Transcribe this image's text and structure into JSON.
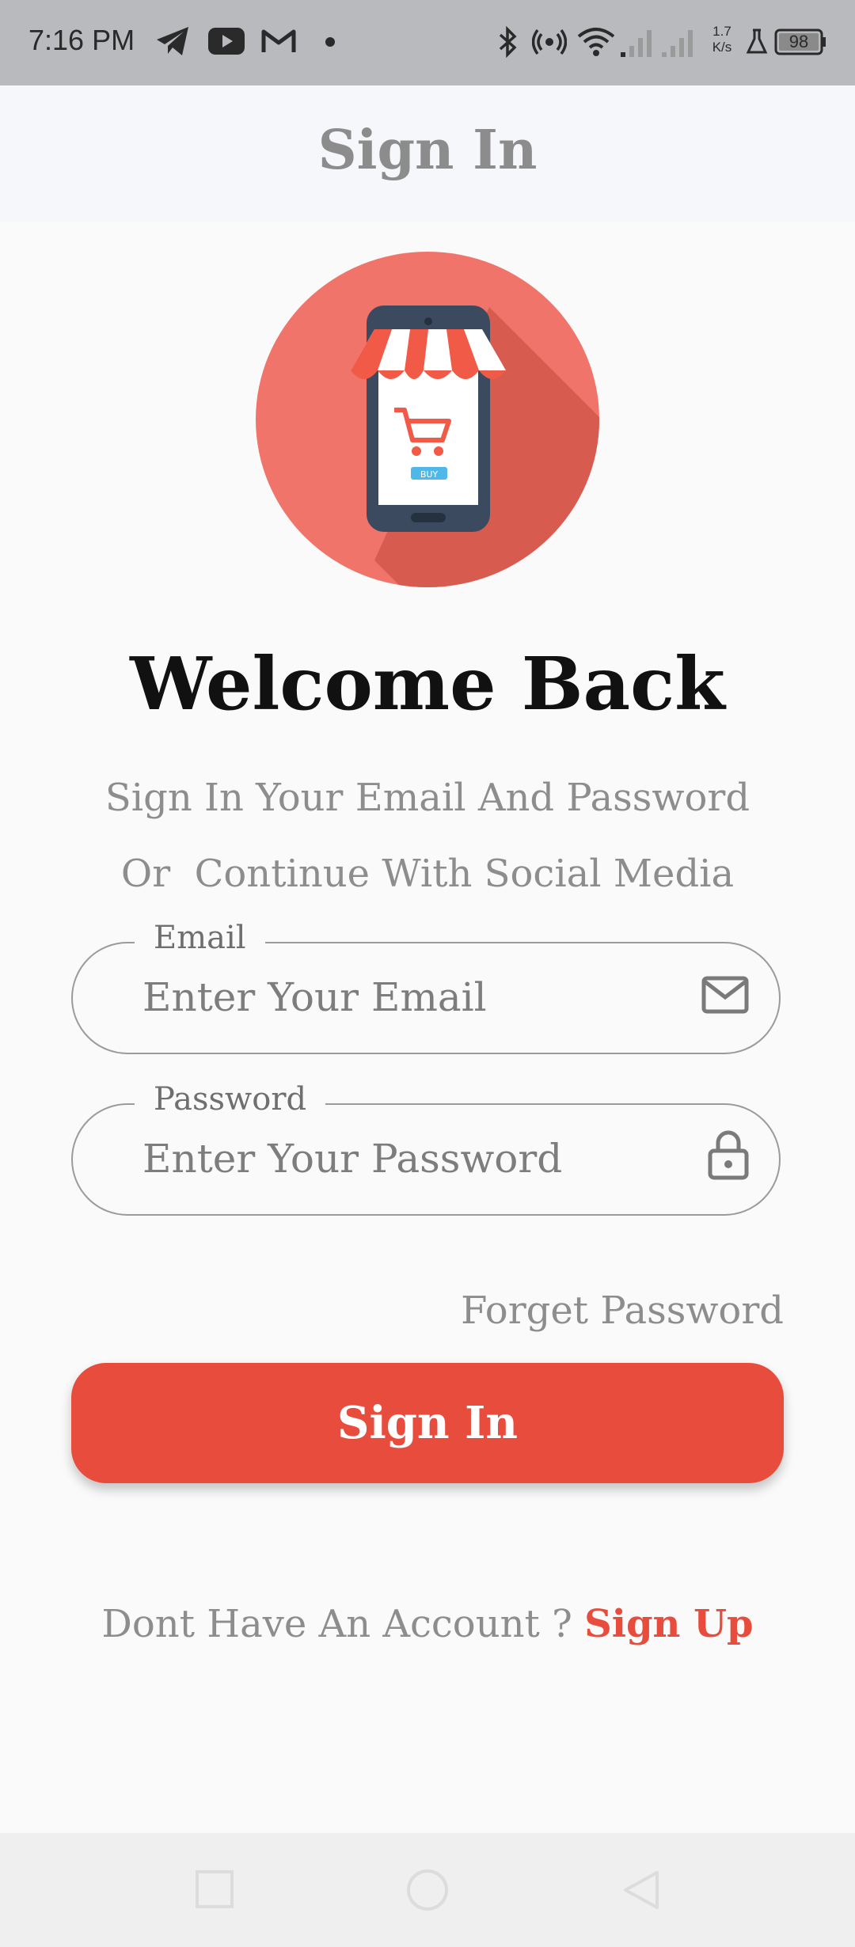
{
  "status_bar": {
    "time": "7:16 PM",
    "net_speed_top": "1.7",
    "net_speed_bottom": "K/s",
    "battery": "98",
    "icons": [
      "telegram-icon",
      "youtube-icon",
      "gmail-icon",
      "dot-icon",
      "bluetooth-icon",
      "hotspot-icon",
      "wifi-icon",
      "signal-icon",
      "signal-icon-2",
      "flask-icon",
      "battery-icon"
    ]
  },
  "app_bar": {
    "title": "Sign In"
  },
  "logo": {
    "icon": "shop-phone-cart-icon",
    "badge": "BUY",
    "accent": "#f07469"
  },
  "welcome": {
    "title": "Welcome Back",
    "line1": "Sign In Your Email And Password",
    "line2": "Or  Continue With Social Media"
  },
  "email": {
    "label": "Email",
    "placeholder": "Enter Your Email",
    "icon": "mail-icon"
  },
  "password": {
    "label": "Password",
    "placeholder": "Enter Your Password",
    "icon": "lock-icon"
  },
  "forget_label": "Forget Password",
  "signin_button": "Sign In",
  "footer": {
    "prompt": "Dont Have An Account ? ",
    "link": "Sign Up"
  },
  "colors": {
    "accent": "#e84c3d",
    "muted": "#8d8d8d"
  },
  "nav_bar": {
    "icons": [
      "recents-icon",
      "home-icon",
      "back-icon"
    ]
  }
}
